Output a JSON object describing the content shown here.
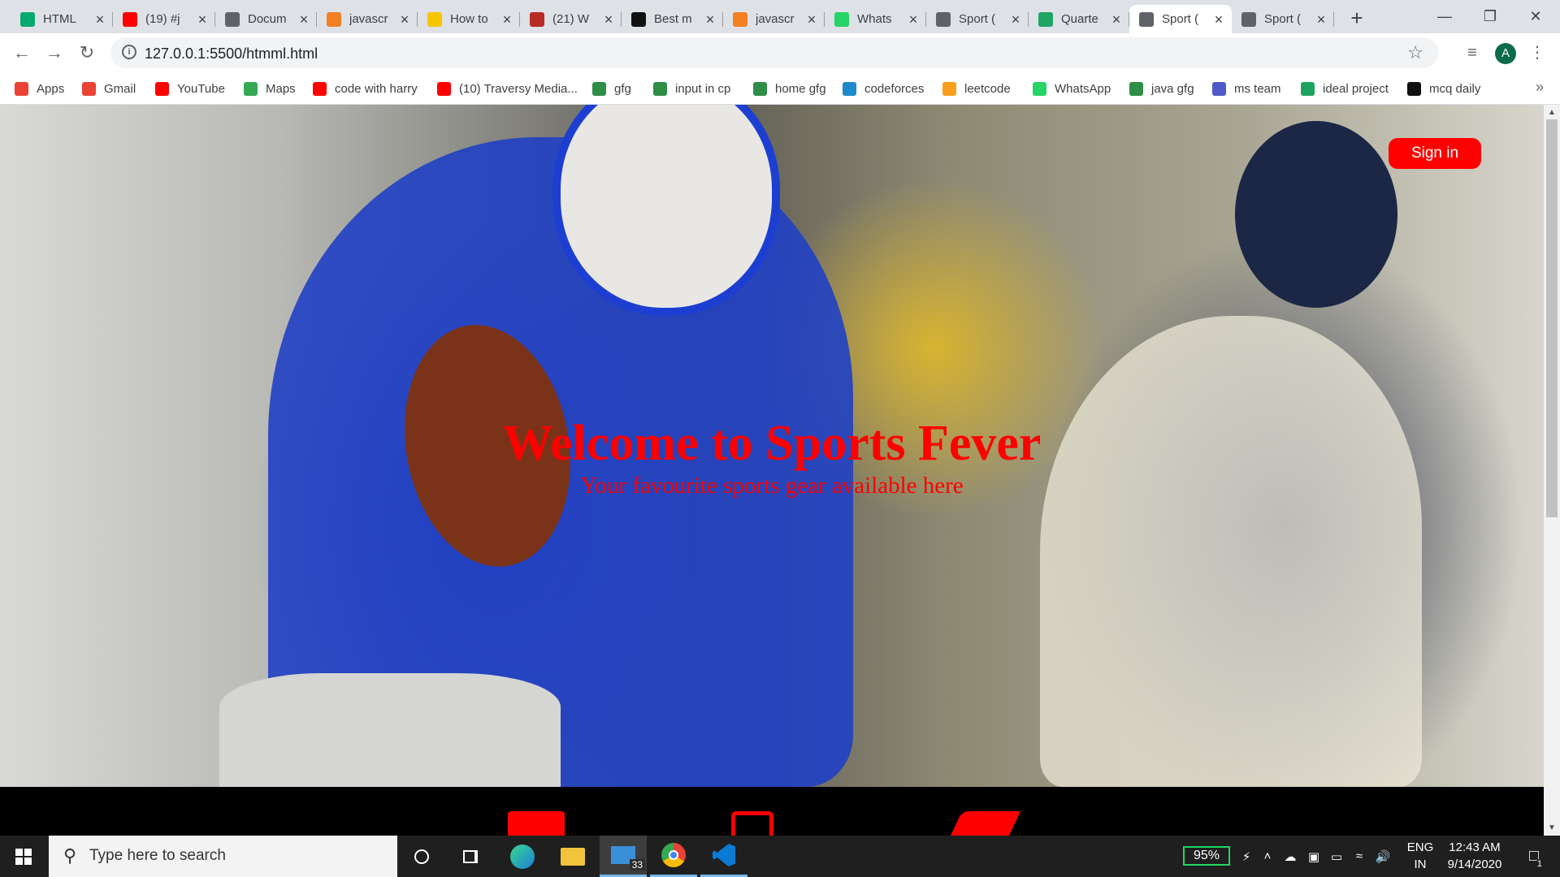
{
  "browser": {
    "tabs": [
      {
        "title": "HTML",
        "icon": "w3schools-icon",
        "color": "#04aa6d"
      },
      {
        "title": "(19) #j",
        "icon": "youtube-icon",
        "color": "#ff0000"
      },
      {
        "title": "Docum",
        "icon": "globe-icon",
        "color": "#5f6368"
      },
      {
        "title": "javascr",
        "icon": "stackoverflow-icon",
        "color": "#f48024"
      },
      {
        "title": "How to",
        "icon": "emoji-icon",
        "color": "#f7c600"
      },
      {
        "title": "(21) W",
        "icon": "quora-icon",
        "color": "#b92b27"
      },
      {
        "title": "Best m",
        "icon": "site-icon",
        "color": "#111111"
      },
      {
        "title": "javascr",
        "icon": "stackoverflow-icon",
        "color": "#f48024"
      },
      {
        "title": "Whats",
        "icon": "whatsapp-icon",
        "color": "#25d366"
      },
      {
        "title": "Sport (",
        "icon": "globe-icon",
        "color": "#5f6368"
      },
      {
        "title": "Quarte",
        "icon": "px-icon",
        "color": "#1fa463"
      },
      {
        "title": "Sport (",
        "icon": "globe-icon",
        "color": "#5f6368",
        "active": true
      },
      {
        "title": "Sport (",
        "icon": "globe-icon",
        "color": "#5f6368"
      }
    ],
    "new_tab": "+",
    "window_controls": {
      "minimize": "—",
      "restore": "❐",
      "close": "✕"
    },
    "url": "127.0.0.1:5500/htmml.html",
    "profile_initial": "A",
    "bookmarks": [
      {
        "label": "Apps",
        "icon": "apps-grid-icon",
        "color": "#ea4335"
      },
      {
        "label": "Gmail",
        "icon": "gmail-icon",
        "color": "#ea4335"
      },
      {
        "label": "YouTube",
        "icon": "youtube-icon",
        "color": "#ff0000"
      },
      {
        "label": "Maps",
        "icon": "maps-icon",
        "color": "#34a853"
      },
      {
        "label": "code with harry",
        "icon": "youtube-icon",
        "color": "#ff0000"
      },
      {
        "label": "(10) Traversy Media...",
        "icon": "youtube-icon",
        "color": "#ff0000"
      },
      {
        "label": "gfg",
        "icon": "gfg-icon",
        "color": "#2f8d46"
      },
      {
        "label": "input in cp",
        "icon": "gfg-icon",
        "color": "#2f8d46"
      },
      {
        "label": "home gfg",
        "icon": "gfg-icon",
        "color": "#2f8d46"
      },
      {
        "label": "codeforces",
        "icon": "codeforces-icon",
        "color": "#1f8acb"
      },
      {
        "label": "leetcode",
        "icon": "leetcode-icon",
        "color": "#f89f1b"
      },
      {
        "label": "WhatsApp",
        "icon": "whatsapp-icon",
        "color": "#25d366"
      },
      {
        "label": "java gfg",
        "icon": "gfg-icon",
        "color": "#2f8d46"
      },
      {
        "label": "ms team",
        "icon": "teams-icon",
        "color": "#5059c9"
      },
      {
        "label": "ideal project",
        "icon": "project-icon",
        "color": "#1ea362"
      },
      {
        "label": "mcq daily",
        "icon": "sf-icon",
        "color": "#111111"
      }
    ],
    "more_bookmarks": "»"
  },
  "page": {
    "signin_label": "Sign in",
    "heading": "Welcome to Sports Fever",
    "tagline": "Your favourite sports gear available here",
    "accent_color": "#ff0000"
  },
  "taskbar": {
    "search_placeholder": "Type here to search",
    "mail_badge": "33",
    "battery": "95%",
    "lang_top": "ENG",
    "lang_bottom": "IN",
    "time": "12:43 AM",
    "date": "9/14/2020",
    "notification_count": "1"
  }
}
